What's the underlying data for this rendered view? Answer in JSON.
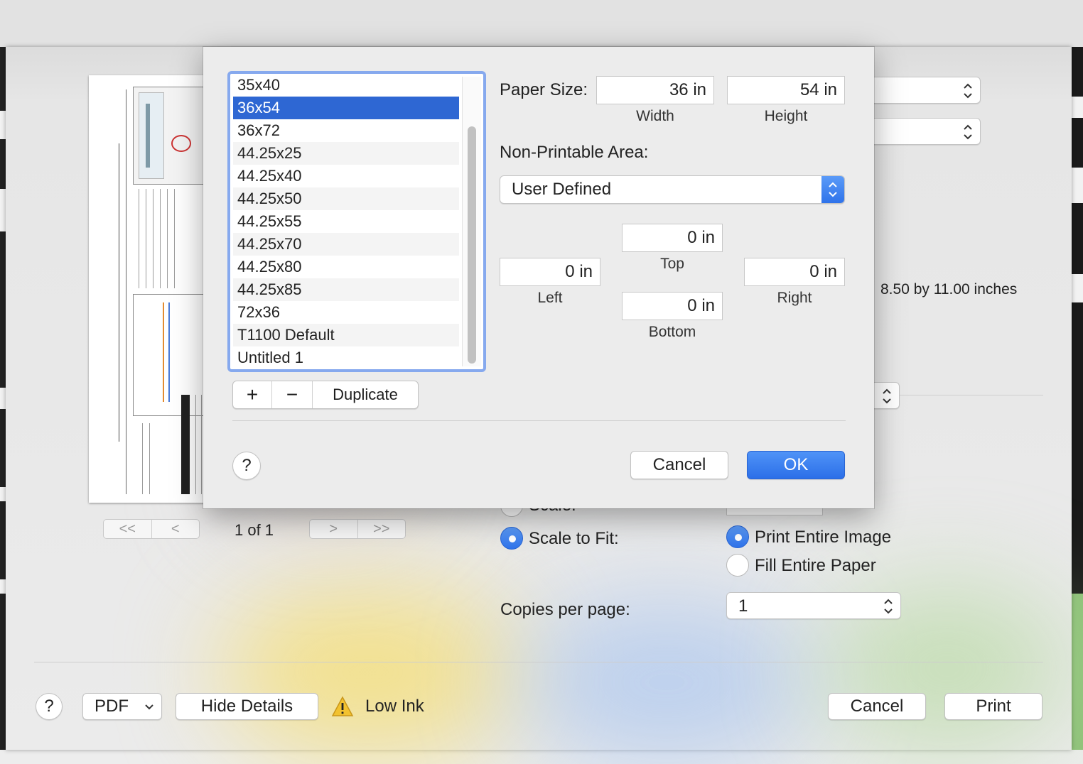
{
  "background": {
    "page_size_info": "8.50 by 11.00 inches"
  },
  "preview": {
    "page_indicator": "1 of 1",
    "first_page": "<<",
    "prev_page": "<",
    "next_page": ">",
    "last_page": ">>"
  },
  "scaling": {
    "scale_label": "Scale:",
    "scale_to_fit_label": "Scale to Fit:",
    "scale_to_fit_selected": true,
    "print_entire_image_label": "Print Entire Image",
    "print_entire_image_selected": true,
    "fill_entire_paper_label": "Fill Entire Paper",
    "copies_per_page_label": "Copies per page:",
    "copies_per_page_value": "1"
  },
  "footer": {
    "help": "?",
    "pdf_label": "PDF",
    "hide_details": "Hide Details",
    "low_ink": "Low Ink",
    "cancel": "Cancel",
    "print": "Print"
  },
  "custom_paper_dialog": {
    "paper_sizes": [
      {
        "label": "35x40",
        "selected": false
      },
      {
        "label": "36x54",
        "selected": true
      },
      {
        "label": "36x72",
        "selected": false
      },
      {
        "label": "44.25x25",
        "selected": false
      },
      {
        "label": "44.25x40",
        "selected": false
      },
      {
        "label": "44.25x50",
        "selected": false
      },
      {
        "label": "44.25x55",
        "selected": false
      },
      {
        "label": "44.25x70",
        "selected": false
      },
      {
        "label": "44.25x80",
        "selected": false
      },
      {
        "label": "44.25x85",
        "selected": false
      },
      {
        "label": "72x36",
        "selected": false
      },
      {
        "label": "T1100 Default",
        "selected": false
      },
      {
        "label": "Untitled 1",
        "selected": false
      }
    ],
    "add_symbol": "+",
    "remove_symbol": "−",
    "duplicate_label": "Duplicate",
    "paper_size_label": "Paper Size:",
    "width_value": "36 in",
    "width_label": "Width",
    "height_value": "54 in",
    "height_label": "Height",
    "non_printable_label": "Non-Printable Area:",
    "non_printable_value": "User Defined",
    "top_value": "0 in",
    "top_label": "Top",
    "left_value": "0 in",
    "left_label": "Left",
    "right_value": "0 in",
    "right_label": "Right",
    "bottom_value": "0 in",
    "bottom_label": "Bottom",
    "help": "?",
    "cancel": "Cancel",
    "ok": "OK"
  },
  "colors": {
    "accent": "#2f73ea",
    "selection": "#2e67d3",
    "focus_ring": "#86a9ee"
  }
}
